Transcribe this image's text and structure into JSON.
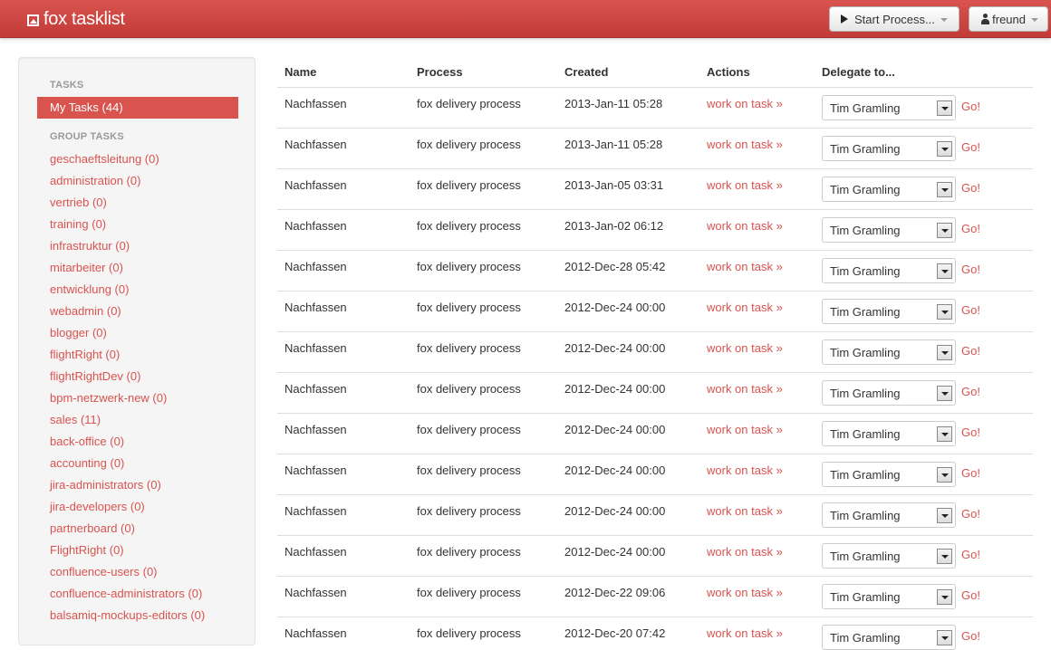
{
  "brand": {
    "title": "fox tasklist"
  },
  "topbar": {
    "start_process_label": "Start Process...",
    "user_label": "freund"
  },
  "sidebar": {
    "tasks_header": "TASKS",
    "my_tasks_label": "My Tasks (44)",
    "group_tasks_header": "GROUP TASKS",
    "groups": [
      "geschaeftsleitung (0)",
      "administration (0)",
      "vertrieb (0)",
      "training (0)",
      "infrastruktur (0)",
      "mitarbeiter (0)",
      "entwicklung (0)",
      "webadmin (0)",
      "blogger (0)",
      "flightRight (0)",
      "flightRightDev (0)",
      "bpm-netzwerk-new (0)",
      "sales (11)",
      "back-office (0)",
      "accounting (0)",
      "jira-administrators (0)",
      "jira-developers (0)",
      "partnerboard (0)",
      "FlightRight (0)",
      "confluence-users (0)",
      "confluence-administrators (0)",
      "balsamiq-mockups-editors (0)"
    ]
  },
  "table": {
    "headers": {
      "name": "Name",
      "process": "Process",
      "created": "Created",
      "actions": "Actions",
      "delegate": "Delegate to..."
    },
    "action_label": "work on task »",
    "go_label": "Go!",
    "rows": [
      {
        "name": "Nachfassen",
        "process": "fox delivery process",
        "created": "2013-Jan-11 05:28",
        "delegate": "Tim Gramling"
      },
      {
        "name": "Nachfassen",
        "process": "fox delivery process",
        "created": "2013-Jan-11 05:28",
        "delegate": "Tim Gramling"
      },
      {
        "name": "Nachfassen",
        "process": "fox delivery process",
        "created": "2013-Jan-05 03:31",
        "delegate": "Tim Gramling"
      },
      {
        "name": "Nachfassen",
        "process": "fox delivery process",
        "created": "2013-Jan-02 06:12",
        "delegate": "Tim Gramling"
      },
      {
        "name": "Nachfassen",
        "process": "fox delivery process",
        "created": "2012-Dec-28 05:42",
        "delegate": "Tim Gramling"
      },
      {
        "name": "Nachfassen",
        "process": "fox delivery process",
        "created": "2012-Dec-24 00:00",
        "delegate": "Tim Gramling"
      },
      {
        "name": "Nachfassen",
        "process": "fox delivery process",
        "created": "2012-Dec-24 00:00",
        "delegate": "Tim Gramling"
      },
      {
        "name": "Nachfassen",
        "process": "fox delivery process",
        "created": "2012-Dec-24 00:00",
        "delegate": "Tim Gramling"
      },
      {
        "name": "Nachfassen",
        "process": "fox delivery process",
        "created": "2012-Dec-24 00:00",
        "delegate": "Tim Gramling"
      },
      {
        "name": "Nachfassen",
        "process": "fox delivery process",
        "created": "2012-Dec-24 00:00",
        "delegate": "Tim Gramling"
      },
      {
        "name": "Nachfassen",
        "process": "fox delivery process",
        "created": "2012-Dec-24 00:00",
        "delegate": "Tim Gramling"
      },
      {
        "name": "Nachfassen",
        "process": "fox delivery process",
        "created": "2012-Dec-24 00:00",
        "delegate": "Tim Gramling"
      },
      {
        "name": "Nachfassen",
        "process": "fox delivery process",
        "created": "2012-Dec-22 09:06",
        "delegate": "Tim Gramling"
      },
      {
        "name": "Nachfassen",
        "process": "fox delivery process",
        "created": "2012-Dec-20 07:42",
        "delegate": "Tim Gramling"
      }
    ]
  },
  "colors": {
    "accent": "#d9534f",
    "header_bar": "#c9403b",
    "sidebar_bg": "#f5f5f5"
  },
  "icons": {
    "brand": "inbox-icon",
    "start": "play-icon",
    "user": "user-icon",
    "dropdown": "caret-down-icon"
  }
}
